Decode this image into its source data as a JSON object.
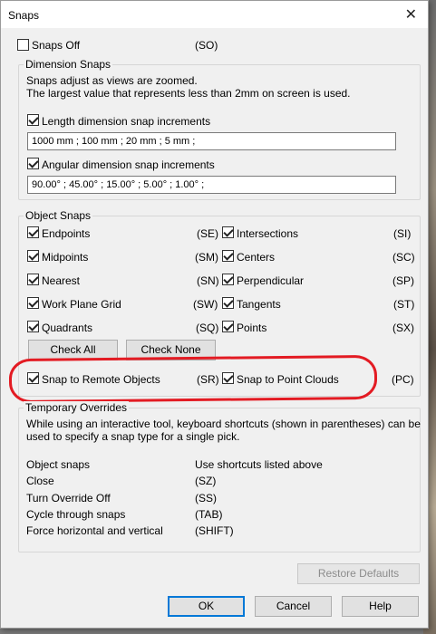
{
  "window": {
    "title": "Snaps",
    "close_label": "✕"
  },
  "snaps_off": {
    "label": "Snaps Off",
    "shortcut": "(SO)",
    "checked": false
  },
  "dimension_snaps": {
    "legend": "Dimension Snaps",
    "info_line1": "Snaps adjust as views are zoomed.",
    "info_line2": "The largest value that represents less than 2mm on screen is used.",
    "length_label": "Length dimension snap increments",
    "length_value": "1000 mm ; 100 mm ; 20 mm ; 5 mm ;",
    "angular_label": "Angular dimension snap increments",
    "angular_value": "90.00° ; 45.00° ; 15.00° ; 5.00° ; 1.00° ;"
  },
  "object_snaps": {
    "legend": "Object Snaps",
    "left": [
      {
        "label": "Endpoints",
        "shortcut": "(SE)"
      },
      {
        "label": "Midpoints",
        "shortcut": "(SM)"
      },
      {
        "label": "Nearest",
        "shortcut": "(SN)"
      },
      {
        "label": "Work Plane Grid",
        "shortcut": "(SW)"
      },
      {
        "label": "Quadrants",
        "shortcut": "(SQ)"
      }
    ],
    "right": [
      {
        "label": "Intersections",
        "shortcut": "(SI)"
      },
      {
        "label": "Centers",
        "shortcut": "(SC)"
      },
      {
        "label": "Perpendicular",
        "shortcut": "(SP)"
      },
      {
        "label": "Tangents",
        "shortcut": "(ST)"
      },
      {
        "label": "Points",
        "shortcut": "(SX)"
      }
    ],
    "check_all": "Check All",
    "check_none": "Check None",
    "remote": {
      "label": "Snap to Remote Objects",
      "shortcut": "(SR)"
    },
    "clouds": {
      "label": "Snap to Point Clouds",
      "shortcut": "(PC)"
    }
  },
  "temporary_overrides": {
    "legend": "Temporary Overrides",
    "info_line1": "While using an interactive tool, keyboard shortcuts (shown in parentheses) can be",
    "info_line2": "used to specify a snap type for a single pick.",
    "rows": [
      {
        "label": "Object snaps",
        "value": "Use shortcuts listed above"
      },
      {
        "label": "Close",
        "value": "(SZ)"
      },
      {
        "label": "Turn Override Off",
        "value": "(SS)"
      },
      {
        "label": "Cycle through snaps",
        "value": "(TAB)"
      },
      {
        "label": "Force horizontal and vertical",
        "value": "(SHIFT)"
      }
    ]
  },
  "buttons": {
    "restore": "Restore Defaults",
    "ok": "OK",
    "cancel": "Cancel",
    "help": "Help"
  },
  "accent_colors": {
    "annotation": "#e31b23",
    "focus": "#0078d7"
  }
}
